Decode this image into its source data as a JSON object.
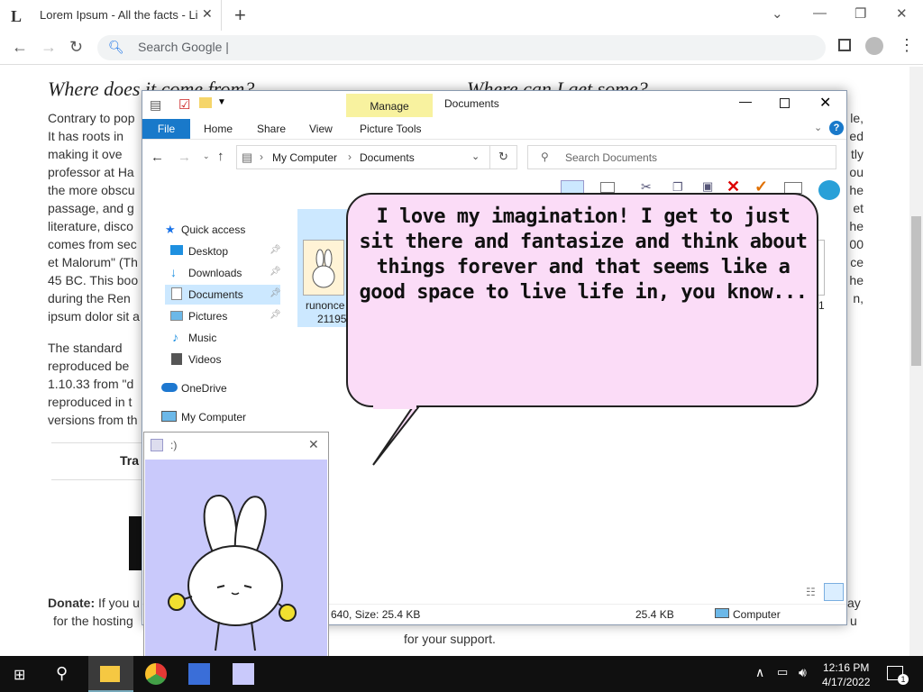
{
  "browser": {
    "tab_favicon": "L",
    "tab_title": "Lorem Ipsum - All the facts - Lipsum",
    "tab_close": "✕",
    "new_tab": "+",
    "omnibox_placeholder": "Search Google |",
    "window_controls": [
      "⌄",
      "—",
      "❐",
      "✕"
    ]
  },
  "webpage": {
    "heading_left": "Where does it come from?",
    "heading_right": "Where can I get some?",
    "para1_lines": [
      "Contrary to pop",
      "It has roots in",
      "making it ove",
      "professor at Ha",
      "the more obscu",
      "passage, and g",
      "literature, disco",
      "comes from sec",
      "et Malorum\" (Th",
      "45 BC. This boo",
      "during the Ren",
      "ipsum dolor sit a"
    ],
    "right_fragments": [
      "le,",
      "ed",
      "tly",
      "ou",
      "he",
      "et",
      "he",
      "00",
      "ce",
      "he",
      "n,"
    ],
    "para2_lines": [
      "The standard",
      "reproduced be",
      "1.10.33 from \"d",
      "reproduced in t",
      "versions from th"
    ],
    "tra_label": "Tra",
    "donate_bold": "Donate:",
    "donate_text": " If you u",
    "donate_line2": "for the hosting",
    "donate_right": "ay",
    "donate_right2": "u",
    "support_text": "for your support."
  },
  "explorer": {
    "title": "Documents",
    "manage_label": "Manage",
    "ribbon_tabs": [
      "File",
      "Home",
      "Share",
      "View",
      "Picture Tools"
    ],
    "breadcrumb": [
      "My Computer",
      "Documents"
    ],
    "search_placeholder": "Search Documents",
    "nav_items": [
      {
        "label": "Quick access",
        "icon": "star-icon"
      },
      {
        "label": "Desktop",
        "icon": "desktop-icon"
      },
      {
        "label": "Downloads",
        "icon": "download-icon"
      },
      {
        "label": "Documents",
        "icon": "documents-icon"
      },
      {
        "label": "Pictures",
        "icon": "pictures-icon"
      },
      {
        "label": "Music",
        "icon": "music-icon"
      },
      {
        "label": "Videos",
        "icon": "videos-icon"
      },
      {
        "label": "OneDrive",
        "icon": "onedrive-icon"
      },
      {
        "label": "My Computer",
        "icon": "computer-icon"
      }
    ],
    "file_name_line1": "runonce",
    "file_name_line2": "21195",
    "right_num": "1",
    "status_dims": "640, Size: 25.4 KB",
    "status_size": "25.4 KB",
    "status_location": "Computer"
  },
  "bubble": {
    "text": "I love my imagination! I get to just sit there and fantasize and think about things forever and that seems like a good space to live life in, you know..."
  },
  "mini_window": {
    "title": ":)",
    "close": "✕"
  },
  "taskbar": {
    "time": "12:16 PM",
    "date": "4/17/2022",
    "notification_count": "1"
  },
  "colors": {
    "file_tab": "#1979ca",
    "manage_tab": "#f8f29f",
    "bubble": "#fbdcf7",
    "mini_bg": "#c9c9fb",
    "selection": "#cce8ff"
  }
}
